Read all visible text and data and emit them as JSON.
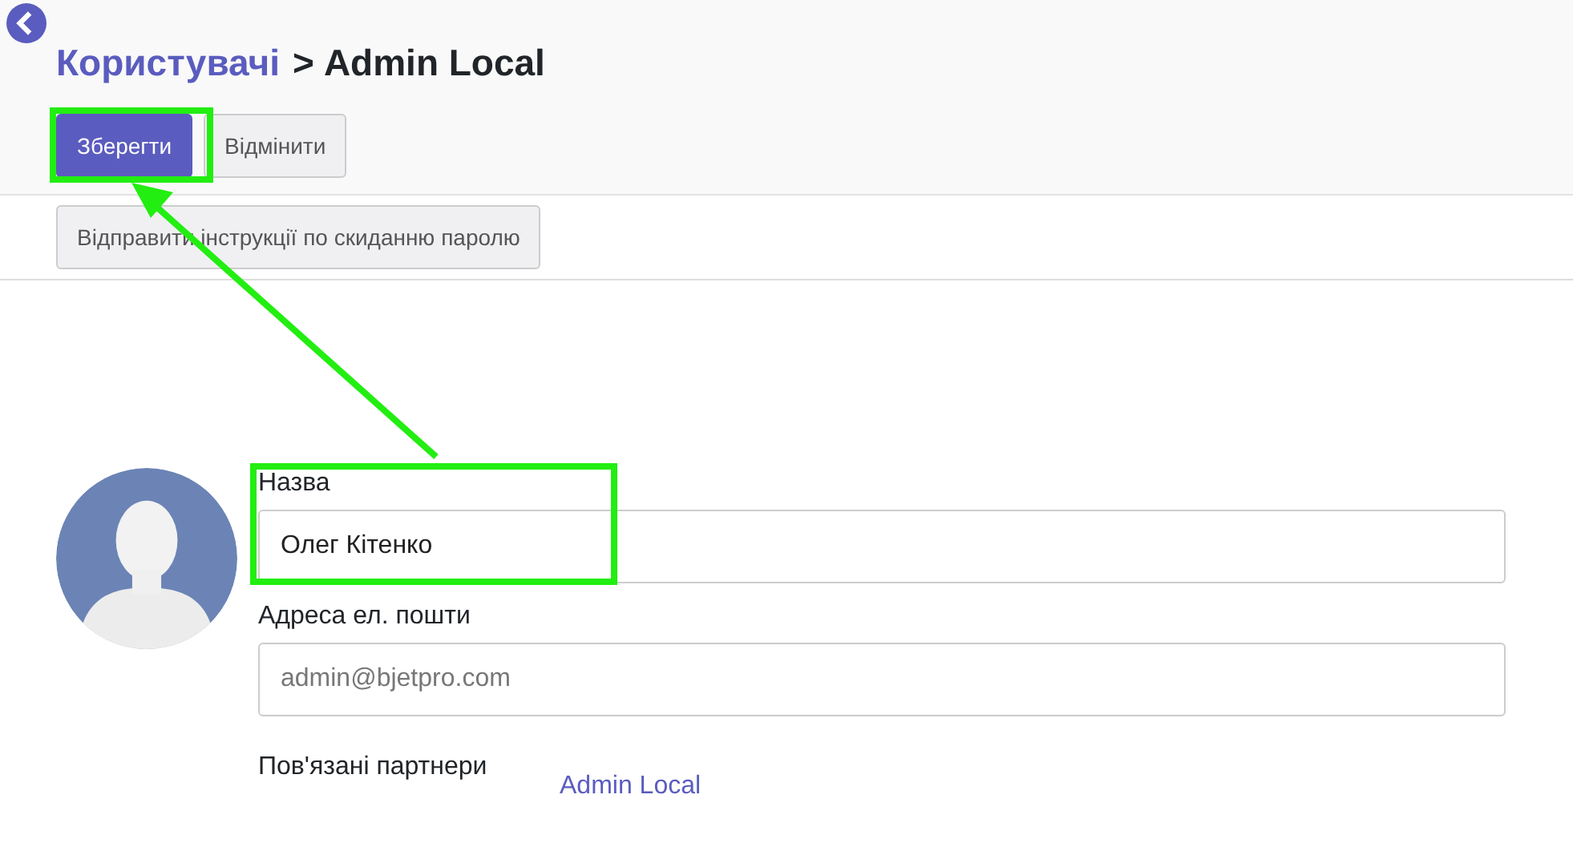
{
  "breadcrumb": {
    "parent": "Користувачі",
    "separator": ">",
    "current": "Admin Local"
  },
  "buttons": [
    {
      "label": "Зберегти",
      "kind": "primary"
    },
    {
      "label": "Відмінити",
      "kind": "secondary"
    }
  ],
  "actions": [
    {
      "label": "Відправити інструкції по скиданню паролю"
    }
  ],
  "form": {
    "name": {
      "label": "Назва",
      "value": "Олег Кітенко"
    },
    "email": {
      "label": "Адреса ел. пошти",
      "placeholder": "admin@bjetpro.com"
    },
    "partners": {
      "label": "Пов'язані партнери",
      "link": "Admin Local"
    }
  },
  "annotations": [
    {
      "kind": "highlight"
    },
    {
      "kind": "highlight"
    },
    {
      "kind": "arrow"
    }
  ]
}
